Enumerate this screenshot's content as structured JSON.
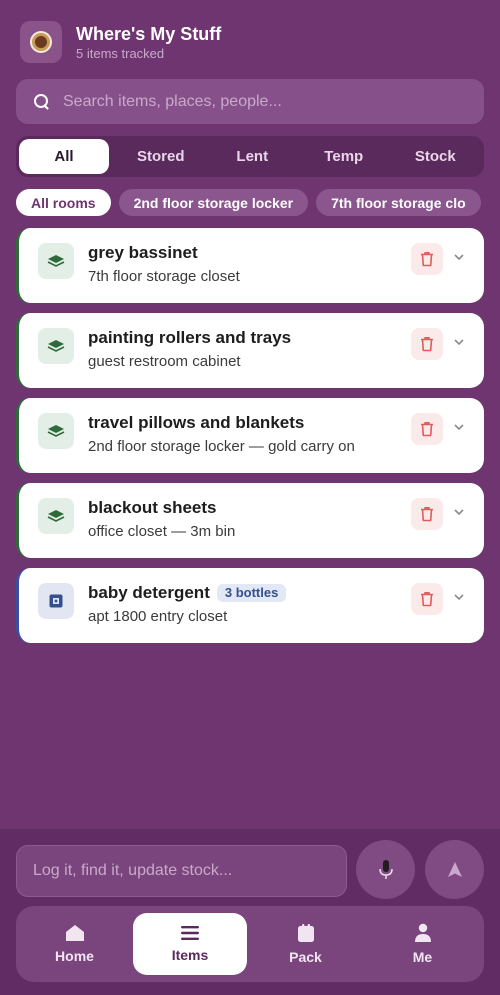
{
  "header": {
    "title": "Where's My Stuff",
    "subtitle": "5 items tracked",
    "icon": "app-logo-icon"
  },
  "search": {
    "placeholder": "Search items, places, people...",
    "icon": "search-icon"
  },
  "segments": {
    "items": [
      {
        "label": "All",
        "active": true
      },
      {
        "label": "Stored",
        "active": false
      },
      {
        "label": "Lent",
        "active": false
      },
      {
        "label": "Temp",
        "active": false
      },
      {
        "label": "Stock",
        "active": false
      }
    ]
  },
  "rooms": {
    "chips": [
      {
        "label": "All rooms",
        "active": true
      },
      {
        "label": "2nd floor storage locker",
        "active": false
      },
      {
        "label": "7th floor storage clo",
        "active": false
      }
    ]
  },
  "items": [
    {
      "name": "grey bassinet",
      "location": "7th floor storage closet",
      "kind": "stored",
      "icon": "layers-icon"
    },
    {
      "name": "painting rollers and trays",
      "location": "guest restroom cabinet",
      "kind": "stored",
      "icon": "layers-icon"
    },
    {
      "name": "travel pillows and blankets",
      "location": "2nd floor storage locker — gold carry on",
      "kind": "stored",
      "icon": "layers-icon"
    },
    {
      "name": "blackout sheets",
      "location": "office closet — 3m bin",
      "kind": "stored",
      "icon": "layers-icon"
    },
    {
      "name": "baby detergent",
      "location": "apt 1800 entry closet",
      "kind": "stock",
      "badge": "3 bottles",
      "icon": "box-icon"
    }
  ],
  "composer": {
    "placeholder": "Log it, find it, update stock..."
  },
  "nav": {
    "items": [
      {
        "label": "Home",
        "icon": "home-icon",
        "active": false
      },
      {
        "label": "Items",
        "icon": "list-icon",
        "active": true
      },
      {
        "label": "Pack",
        "icon": "bag-icon",
        "active": false
      },
      {
        "label": "Me",
        "icon": "person-icon",
        "active": false
      }
    ]
  },
  "colors": {
    "background": "#6f3570",
    "stored_accent": "#2f6b3a",
    "stock_accent": "#3a4fa0",
    "delete_red": "#e05a5a"
  }
}
